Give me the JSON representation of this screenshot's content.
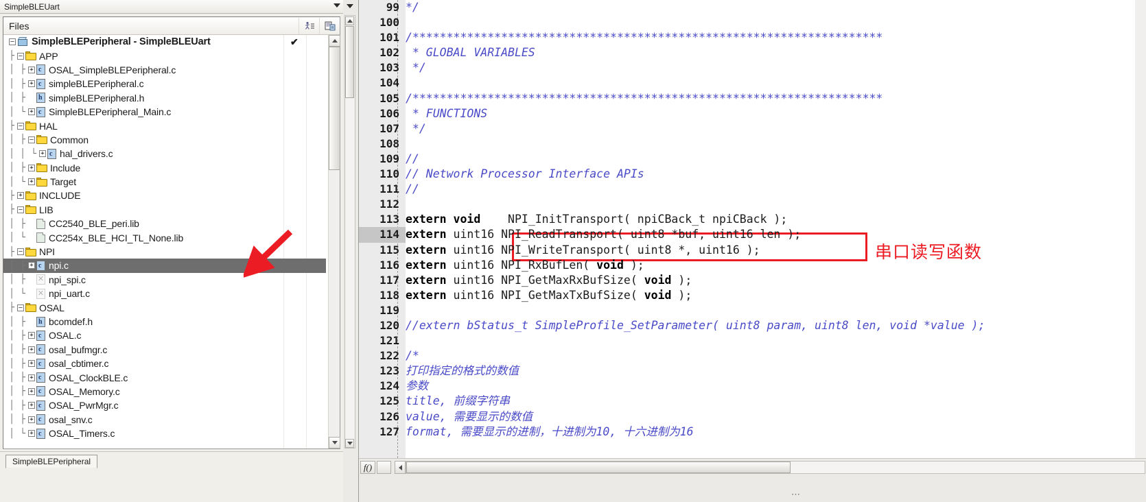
{
  "workspace": {
    "title": "SimpleBLEUart",
    "dropdown_icon": "chevron-down-icon",
    "files_header": {
      "label": "Files",
      "icons": [
        "make-icon",
        "compile-icon"
      ]
    },
    "tree": [
      {
        "depth": 0,
        "label": "SimpleBLEPeripheral - SimpleBLEUart",
        "icon": "project-icon",
        "expander": "-",
        "bold": true,
        "checked": true
      },
      {
        "depth": 1,
        "label": "APP",
        "icon": "folder-icon",
        "expander": "-"
      },
      {
        "depth": 2,
        "label": "OSAL_SimpleBLEPeripheral.c",
        "icon": "c-file-icon",
        "expander": "+"
      },
      {
        "depth": 2,
        "label": "simpleBLEPeripheral.c",
        "icon": "c-file-icon",
        "expander": "+"
      },
      {
        "depth": 2,
        "label": "simpleBLEPeripheral.h",
        "icon": "h-file-icon",
        "expander": ""
      },
      {
        "depth": 2,
        "label": "SimpleBLEPeripheral_Main.c",
        "icon": "c-file-icon",
        "expander": "+",
        "last": true
      },
      {
        "depth": 1,
        "label": "HAL",
        "icon": "folder-icon",
        "expander": "-"
      },
      {
        "depth": 2,
        "label": "Common",
        "icon": "folder-icon",
        "expander": "-"
      },
      {
        "depth": 3,
        "label": "hal_drivers.c",
        "icon": "c-file-icon",
        "expander": "+",
        "last": true
      },
      {
        "depth": 2,
        "label": "Include",
        "icon": "folder-icon",
        "expander": "+"
      },
      {
        "depth": 2,
        "label": "Target",
        "icon": "folder-icon",
        "expander": "+",
        "last": true
      },
      {
        "depth": 1,
        "label": "INCLUDE",
        "icon": "folder-icon",
        "expander": "+"
      },
      {
        "depth": 1,
        "label": "LIB",
        "icon": "folder-icon",
        "expander": "-"
      },
      {
        "depth": 2,
        "label": "CC2540_BLE_peri.lib",
        "icon": "lib-file-icon",
        "expander": ""
      },
      {
        "depth": 2,
        "label": "CC254x_BLE_HCI_TL_None.lib",
        "icon": "lib-file-icon",
        "expander": "",
        "last": true
      },
      {
        "depth": 1,
        "label": "NPI",
        "icon": "folder-icon",
        "expander": "-"
      },
      {
        "depth": 2,
        "label": "npi.c",
        "icon": "c-file-icon",
        "expander": "+",
        "selected": true
      },
      {
        "depth": 2,
        "label": "npi_spi.c",
        "icon": "excluded-file-icon",
        "expander": ""
      },
      {
        "depth": 2,
        "label": "npi_uart.c",
        "icon": "excluded-file-icon",
        "expander": "",
        "last": true
      },
      {
        "depth": 1,
        "label": "OSAL",
        "icon": "folder-icon",
        "expander": "-"
      },
      {
        "depth": 2,
        "label": "bcomdef.h",
        "icon": "h-file-icon",
        "expander": ""
      },
      {
        "depth": 2,
        "label": "OSAL.c",
        "icon": "c-file-icon",
        "expander": "+"
      },
      {
        "depth": 2,
        "label": "osal_bufmgr.c",
        "icon": "c-file-icon",
        "expander": "+"
      },
      {
        "depth": 2,
        "label": "osal_cbtimer.c",
        "icon": "c-file-icon",
        "expander": "+"
      },
      {
        "depth": 2,
        "label": "OSAL_ClockBLE.c",
        "icon": "c-file-icon",
        "expander": "+"
      },
      {
        "depth": 2,
        "label": "OSAL_Memory.c",
        "icon": "c-file-icon",
        "expander": "+"
      },
      {
        "depth": 2,
        "label": "OSAL_PwrMgr.c",
        "icon": "c-file-icon",
        "expander": "+"
      },
      {
        "depth": 2,
        "label": "osal_snv.c",
        "icon": "c-file-icon",
        "expander": "+"
      },
      {
        "depth": 2,
        "label": "OSAL_Timers.c",
        "icon": "c-file-icon",
        "expander": "+",
        "last": true
      }
    ],
    "bottom_tab": "SimpleBLEPeripheral"
  },
  "editor": {
    "first_line_number": 99,
    "current_line": 114,
    "lines": [
      {
        "n": 99,
        "segments": [
          {
            "t": "*/",
            "s": "cmt"
          }
        ]
      },
      {
        "n": 100,
        "segments": []
      },
      {
        "n": 101,
        "segments": [
          {
            "t": "/*********************************************************************",
            "s": "cmt"
          }
        ]
      },
      {
        "n": 102,
        "segments": [
          {
            "t": " * GLOBAL VARIABLES",
            "s": "cmt"
          }
        ]
      },
      {
        "n": 103,
        "segments": [
          {
            "t": " */",
            "s": "cmt"
          }
        ]
      },
      {
        "n": 104,
        "segments": []
      },
      {
        "n": 105,
        "segments": [
          {
            "t": "/*********************************************************************",
            "s": "cmt"
          }
        ]
      },
      {
        "n": 106,
        "segments": [
          {
            "t": " * FUNCTIONS",
            "s": "cmt"
          }
        ]
      },
      {
        "n": 107,
        "segments": [
          {
            "t": " */",
            "s": "cmt"
          }
        ]
      },
      {
        "n": 108,
        "segments": []
      },
      {
        "n": 109,
        "segments": [
          {
            "t": "//",
            "s": "cmt"
          }
        ]
      },
      {
        "n": 110,
        "segments": [
          {
            "t": "// Network Processor Interface APIs",
            "s": "cmt"
          }
        ]
      },
      {
        "n": 111,
        "segments": [
          {
            "t": "//",
            "s": "cmt"
          }
        ]
      },
      {
        "n": 112,
        "segments": []
      },
      {
        "n": 113,
        "segments": [
          {
            "t": "extern void",
            "s": "kw"
          },
          {
            "t": "    NPI_InitTransport( npiCBack_t npiCBack );",
            "s": "plain"
          }
        ]
      },
      {
        "n": 114,
        "segments": [
          {
            "t": "extern",
            "s": "kw"
          },
          {
            "t": " uint16 NPI_ReadTransport( uint8 *buf, uint16 len );",
            "s": "plain"
          }
        ]
      },
      {
        "n": 115,
        "segments": [
          {
            "t": "extern",
            "s": "kw"
          },
          {
            "t": " uint16 NPI_WriteTransport( uint8 *, uint16 );",
            "s": "plain"
          }
        ]
      },
      {
        "n": 116,
        "segments": [
          {
            "t": "extern",
            "s": "kw"
          },
          {
            "t": " uint16 NPI_RxBufLen( ",
            "s": "plain"
          },
          {
            "t": "void",
            "s": "kw"
          },
          {
            "t": " );",
            "s": "plain"
          }
        ]
      },
      {
        "n": 117,
        "segments": [
          {
            "t": "extern",
            "s": "kw"
          },
          {
            "t": " uint16 NPI_GetMaxRxBufSize( ",
            "s": "plain"
          },
          {
            "t": "void",
            "s": "kw"
          },
          {
            "t": " );",
            "s": "plain"
          }
        ]
      },
      {
        "n": 118,
        "segments": [
          {
            "t": "extern",
            "s": "kw"
          },
          {
            "t": " uint16 NPI_GetMaxTxBufSize( ",
            "s": "plain"
          },
          {
            "t": "void",
            "s": "kw"
          },
          {
            "t": " );",
            "s": "plain"
          }
        ]
      },
      {
        "n": 119,
        "segments": []
      },
      {
        "n": 120,
        "segments": [
          {
            "t": "//extern bStatus_t SimpleProfile_SetParameter( uint8 param, uint8 len, void *value );",
            "s": "cmt"
          }
        ]
      },
      {
        "n": 121,
        "segments": []
      },
      {
        "n": 122,
        "segments": [
          {
            "t": "/*",
            "s": "cmt"
          }
        ]
      },
      {
        "n": 123,
        "segments": [
          {
            "t": "打印指定的格式的数值",
            "s": "cmt"
          }
        ]
      },
      {
        "n": 124,
        "segments": [
          {
            "t": "参数",
            "s": "cmt"
          }
        ]
      },
      {
        "n": 125,
        "segments": [
          {
            "t": "title, 前缀字符串",
            "s": "cmt"
          }
        ]
      },
      {
        "n": 126,
        "segments": [
          {
            "t": "value, 需要显示的数值",
            "s": "cmt"
          }
        ]
      },
      {
        "n": 127,
        "segments": [
          {
            "t": "format, 需要显示的进制，十进制为10, 十六进制为16",
            "s": "cmt"
          }
        ]
      }
    ]
  },
  "annotations": {
    "red_box_label": "串口读写函数",
    "red_color": "#ec1c24",
    "arrow": "red-arrow-pointing-to-npi-c"
  },
  "colors": {
    "comment": "#4a4ac8",
    "selection_bg": "#6e6e6e",
    "gutter_bg": "#ebebeb",
    "window_chrome": "#f1efea"
  }
}
